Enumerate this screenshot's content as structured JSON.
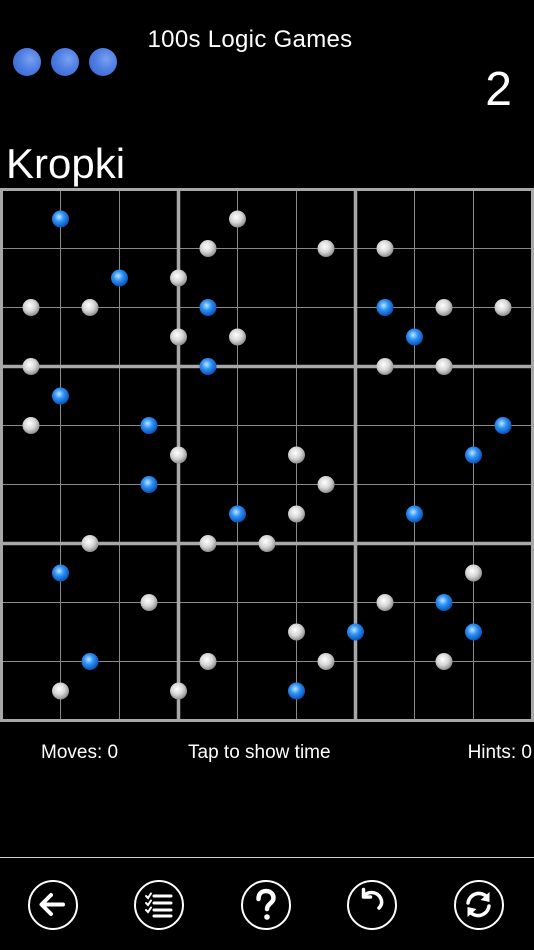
{
  "header": {
    "app_title": "100s Logic Games",
    "level_number": "2",
    "menu_dots_color": "#4e7ee4"
  },
  "puzzle": {
    "name": "Kropki",
    "grid_size": 9,
    "box_size": 3,
    "colors": {
      "background": "#000000",
      "grid_line": "#a8a8a8",
      "white_dot": "#d8d8d8",
      "blue_dot": "#2a8cf0"
    },
    "dots": [
      {
        "row": 0.5,
        "col": 1,
        "color": "blue"
      },
      {
        "row": 0.5,
        "col": 4,
        "color": "white"
      },
      {
        "row": 1,
        "col": 3.5,
        "color": "white"
      },
      {
        "row": 1,
        "col": 5.5,
        "color": "white"
      },
      {
        "row": 1,
        "col": 6.5,
        "color": "white"
      },
      {
        "row": 1.5,
        "col": 2,
        "color": "blue"
      },
      {
        "row": 1.5,
        "col": 3,
        "color": "white"
      },
      {
        "row": 2,
        "col": 0.5,
        "color": "white"
      },
      {
        "row": 2,
        "col": 1.5,
        "color": "white"
      },
      {
        "row": 2,
        "col": 3.5,
        "color": "blue"
      },
      {
        "row": 2,
        "col": 6.5,
        "color": "blue"
      },
      {
        "row": 2,
        "col": 7.5,
        "color": "white"
      },
      {
        "row": 2,
        "col": 8.5,
        "color": "white"
      },
      {
        "row": 2.5,
        "col": 3,
        "color": "white"
      },
      {
        "row": 2.5,
        "col": 4,
        "color": "white"
      },
      {
        "row": 2.5,
        "col": 7,
        "color": "blue"
      },
      {
        "row": 3,
        "col": 0.5,
        "color": "white"
      },
      {
        "row": 3,
        "col": 3.5,
        "color": "blue"
      },
      {
        "row": 3,
        "col": 6.5,
        "color": "white"
      },
      {
        "row": 3,
        "col": 7.5,
        "color": "white"
      },
      {
        "row": 3.5,
        "col": 1,
        "color": "blue"
      },
      {
        "row": 4,
        "col": 0.5,
        "color": "white"
      },
      {
        "row": 4,
        "col": 2.5,
        "color": "blue"
      },
      {
        "row": 4,
        "col": 8.5,
        "color": "blue"
      },
      {
        "row": 4.5,
        "col": 3,
        "color": "white"
      },
      {
        "row": 4.5,
        "col": 5,
        "color": "white"
      },
      {
        "row": 4.5,
        "col": 8,
        "color": "blue"
      },
      {
        "row": 5,
        "col": 2.5,
        "color": "blue"
      },
      {
        "row": 5,
        "col": 5.5,
        "color": "white"
      },
      {
        "row": 5.5,
        "col": 4,
        "color": "blue"
      },
      {
        "row": 5.5,
        "col": 5,
        "color": "white"
      },
      {
        "row": 5.5,
        "col": 7,
        "color": "blue"
      },
      {
        "row": 6,
        "col": 1.5,
        "color": "white"
      },
      {
        "row": 6,
        "col": 3.5,
        "color": "white"
      },
      {
        "row": 6,
        "col": 4.5,
        "color": "white"
      },
      {
        "row": 6.5,
        "col": 1,
        "color": "blue"
      },
      {
        "row": 6.5,
        "col": 8,
        "color": "white"
      },
      {
        "row": 7,
        "col": 2.5,
        "color": "white"
      },
      {
        "row": 7,
        "col": 6.5,
        "color": "white"
      },
      {
        "row": 7,
        "col": 7.5,
        "color": "blue"
      },
      {
        "row": 7.5,
        "col": 5,
        "color": "white"
      },
      {
        "row": 7.5,
        "col": 6,
        "color": "blue"
      },
      {
        "row": 7.5,
        "col": 8,
        "color": "blue"
      },
      {
        "row": 8,
        "col": 1.5,
        "color": "blue"
      },
      {
        "row": 8,
        "col": 3.5,
        "color": "white"
      },
      {
        "row": 8,
        "col": 5.5,
        "color": "white"
      },
      {
        "row": 8,
        "col": 7.5,
        "color": "white"
      },
      {
        "row": 8.5,
        "col": 1,
        "color": "white"
      },
      {
        "row": 8.5,
        "col": 3,
        "color": "white"
      },
      {
        "row": 8.5,
        "col": 5,
        "color": "blue"
      }
    ]
  },
  "status": {
    "moves": "Moves: 0",
    "time_prompt": "Tap to show time",
    "hints": "Hints: 0"
  },
  "toolbar": {
    "buttons": [
      {
        "name": "back",
        "icon": "arrow-left-icon"
      },
      {
        "name": "menu",
        "icon": "checklist-icon"
      },
      {
        "name": "help",
        "icon": "question-icon"
      },
      {
        "name": "undo",
        "icon": "undo-icon"
      },
      {
        "name": "restart",
        "icon": "refresh-icon"
      }
    ]
  }
}
